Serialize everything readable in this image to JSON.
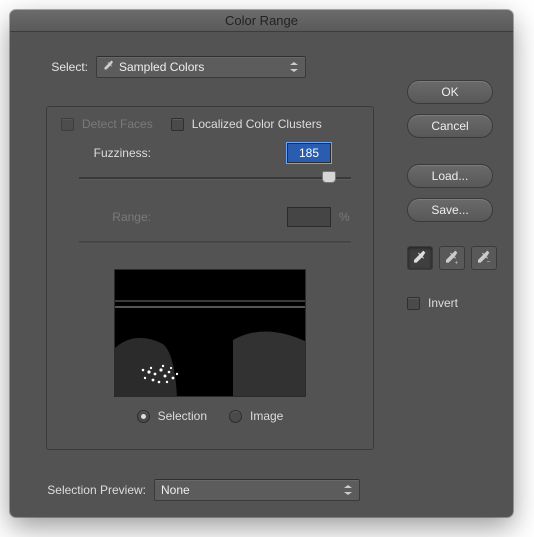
{
  "title": "Color Range",
  "select": {
    "label": "Select:",
    "value": "Sampled Colors"
  },
  "detectFaces": {
    "label": "Detect Faces",
    "checked": false,
    "enabled": false
  },
  "localized": {
    "label": "Localized Color Clusters",
    "checked": false
  },
  "fuzziness": {
    "label": "Fuzziness:",
    "value": "185",
    "min": 0,
    "max": 200,
    "pos": 0.92
  },
  "range": {
    "label": "Range:",
    "value": "",
    "suffix": "%",
    "enabled": false
  },
  "previewMode": {
    "selection": {
      "label": "Selection",
      "checked": true
    },
    "image": {
      "label": "Image",
      "checked": false
    }
  },
  "selectionPreview": {
    "label": "Selection Preview:",
    "value": "None"
  },
  "buttons": {
    "ok": "OK",
    "cancel": "Cancel",
    "load": "Load...",
    "save": "Save..."
  },
  "tools": {
    "eyedropper": "eyedropper",
    "eyedropperAdd": "eyedropper-add",
    "eyedropperSub": "eyedropper-subtract"
  },
  "invert": {
    "label": "Invert",
    "checked": false
  }
}
